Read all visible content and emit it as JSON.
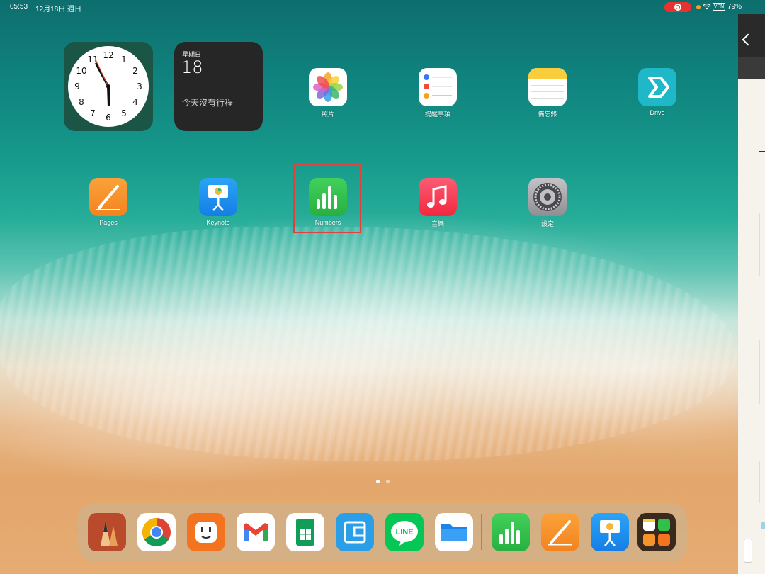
{
  "status_bar": {
    "time": "05:53",
    "date": "12月18日 週日",
    "vpn": "VPN",
    "battery": "79%"
  },
  "widgets": {
    "clock": {
      "numbers": [
        "12",
        "1",
        "2",
        "3",
        "4",
        "5",
        "6",
        "7",
        "8",
        "9",
        "10",
        "11"
      ]
    },
    "calendar": {
      "weekday": "星期日",
      "day": "18",
      "events": "今天沒有行程"
    }
  },
  "apps": [
    {
      "label": "照片",
      "icon": "photos-icon"
    },
    {
      "label": "提醒事項",
      "icon": "reminders-icon"
    },
    {
      "label": "備忘錄",
      "icon": "notes-icon"
    },
    {
      "label": "Drive",
      "icon": "drive-icon"
    },
    {
      "label": "Pages",
      "icon": "pages-icon"
    },
    {
      "label": "Keynote",
      "icon": "keynote-icon"
    },
    {
      "label": "Numbers",
      "icon": "numbers-icon"
    },
    {
      "label": "音樂",
      "icon": "music-icon"
    },
    {
      "label": "設定",
      "icon": "settings-icon"
    }
  ],
  "dock": [
    {
      "icon": "sketch-pencil-icon"
    },
    {
      "icon": "chrome-icon"
    },
    {
      "icon": "outlet-icon"
    },
    {
      "icon": "gmail-icon"
    },
    {
      "icon": "google-sheets-icon"
    },
    {
      "icon": "wallet-icon"
    },
    {
      "icon": "line-icon",
      "label": "LINE"
    },
    {
      "icon": "files-icon"
    },
    {
      "icon": "numbers-icon"
    },
    {
      "icon": "pages-icon"
    },
    {
      "icon": "keynote-icon"
    },
    {
      "icon": "app-library-icon"
    }
  ],
  "colors": {
    "highlight": "#e23f3f",
    "numbers_green": "#30c14a",
    "pages_orange": "#f7932b",
    "keynote_blue": "#1d8cf0"
  }
}
